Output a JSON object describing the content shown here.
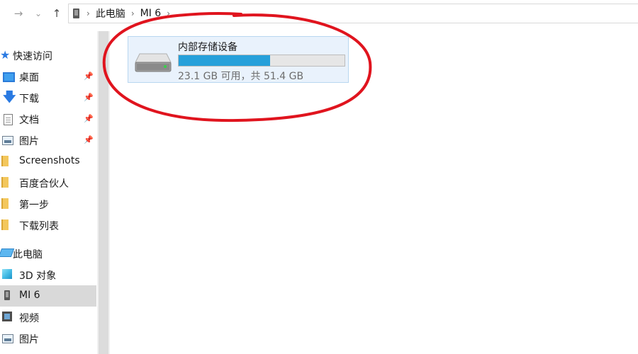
{
  "address_bar": {
    "breadcrumbs": [
      "此电脑",
      "MI 6"
    ]
  },
  "sidebar": {
    "quick_access": {
      "label": "快速访问",
      "items": [
        {
          "label": "桌面",
          "icon": "desktop-icon",
          "pinned": true
        },
        {
          "label": "下载",
          "icon": "download-arrow-icon",
          "pinned": true
        },
        {
          "label": "文档",
          "icon": "document-icon",
          "pinned": true
        },
        {
          "label": "图片",
          "icon": "pictures-icon",
          "pinned": true
        },
        {
          "label": "Screenshots",
          "icon": "folder-icon",
          "pinned": false
        },
        {
          "label": "百度合伙人",
          "icon": "folder-icon",
          "pinned": false
        },
        {
          "label": "第一步",
          "icon": "folder-icon",
          "pinned": false
        },
        {
          "label": "下载列表",
          "icon": "folder-icon",
          "pinned": false
        }
      ]
    },
    "this_pc": {
      "label": "此电脑",
      "items": [
        {
          "label": "3D 对象",
          "icon": "3d-objects-icon",
          "selected": false
        },
        {
          "label": "MI 6",
          "icon": "phone-device-icon",
          "selected": true
        },
        {
          "label": "视频",
          "icon": "video-icon",
          "selected": false
        },
        {
          "label": "图片",
          "icon": "pictures-icon",
          "selected": false
        }
      ]
    }
  },
  "content": {
    "drive": {
      "name": "内部存储设备",
      "space_text": "23.1 GB 可用，共 51.4 GB",
      "used_fraction": 0.55
    }
  },
  "colors": {
    "usage_bar": "#26a0da",
    "selection": "#d9d9d9",
    "annotation": "#e0141e"
  }
}
